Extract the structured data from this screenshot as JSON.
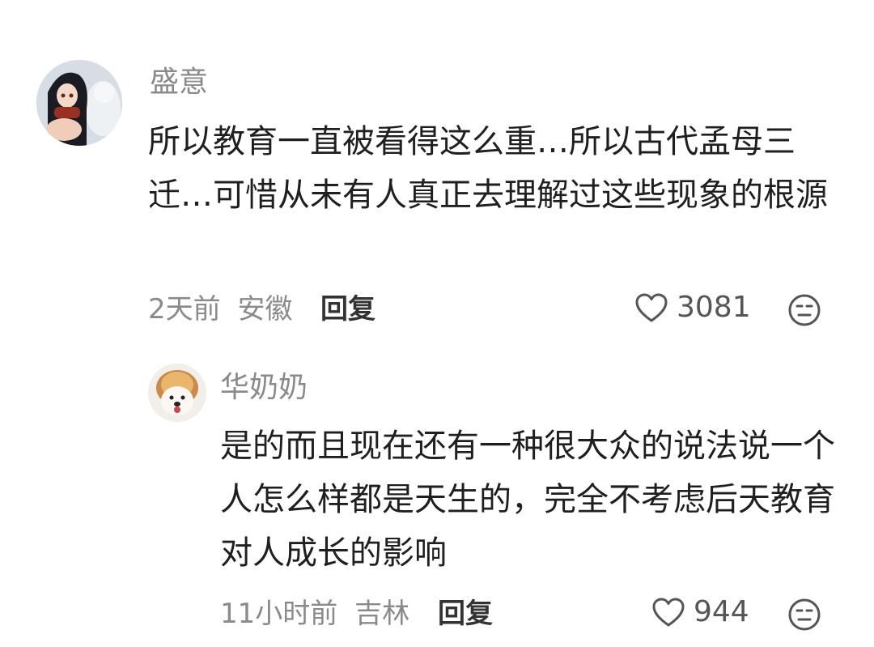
{
  "comments": [
    {
      "username": "盛意",
      "text": "所以教育一直被看得这么重…所以古代孟母三迁…可惜从未有人真正去理解过这些现象的根源",
      "time": "2天前",
      "location": "安徽",
      "reply_label": "回复",
      "likes": "3081",
      "avatar_icon": "anime-girl-avatar",
      "like_icon": "heart-outline-icon",
      "reaction_icon": "neutral-face-icon"
    },
    {
      "username": "华奶奶",
      "text": "是的而且现在还有一种很大众的说法说一个人怎么样都是天生的，完全不考虑后天教育对人成长的影响",
      "time": "11小时前",
      "location": "吉林",
      "reply_label": "回复",
      "likes": "944",
      "avatar_icon": "puppy-lion-hat-avatar",
      "like_icon": "heart-outline-icon",
      "reaction_icon": "neutral-face-icon"
    }
  ],
  "colors": {
    "username": "#8a8a8a",
    "body_text": "#1f1f1f",
    "meta": "#8a8a8a",
    "reply": "#333333"
  }
}
